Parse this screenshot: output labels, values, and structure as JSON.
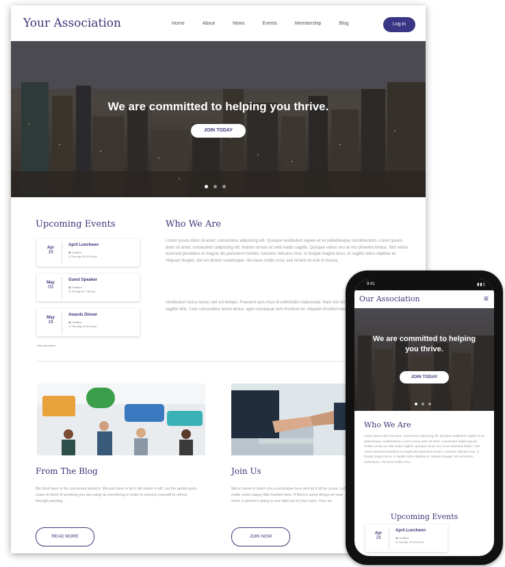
{
  "desktop": {
    "brand": "Your Association",
    "nav": [
      "Home",
      "About",
      "News",
      "Events",
      "Membership",
      "Blog"
    ],
    "login": "Log in",
    "hero_title": "We are committed to helping you thrive.",
    "hero_button": "JOIN TODAY",
    "events_title": "Upcoming Events",
    "events": [
      {
        "month": "Apr",
        "day": "16",
        "title": "April Luncheon",
        "location": "Location",
        "time": "Tue Apr 16 12:00 pm"
      },
      {
        "month": "May",
        "day": "03",
        "title": "Guest Speaker",
        "location": "Location",
        "time": "Fri May 03 7:00 pm"
      },
      {
        "month": "May",
        "day": "16",
        "title": "Awards Dinner",
        "location": "Location",
        "time": "Thu May 16 6:00 pm"
      }
    ],
    "events_link": "View all events",
    "who_title": "Who We Are",
    "who_p1": "Lorem ipsum dolor sit amet, consectetur adipiscing elit. Quisque vestibulum sapien et ex pellentesque condimentum. Lorem ipsum dolor sit amet, consectetur adipiscing elit. Nullam ornare ac velit mattis sagittis. Quisque varius orci at orci pharetra finibus. Nisl varius euismod penatibus et magnis dis parturient montes, nascetur ridiculus mus. In feugiat magna lacus, in sagittis tellus dapibus et. Aliquam feugiat, nisl vel dictum scelerisque, nisi lacus mollis urna, sed ornare mi erat ut massa.",
    "who_p2": "Vestibulum luctus lectus sed est tempor. Praesent quis risus id sollicitudin malesuada. Nam non tortor id mauris pharetra porta quis sagittis felis. Cras consectetur lectus lectus, eget consequat sem tincidunt ex. Aliquam tincidunt lacus sapien vitae auctor.",
    "blog_title": "From The Blog",
    "blog_text": "We dont have to be concerned about it. We just have to let it fall where it will. Let the gentle push. Learn to think of anything you are using as something in order to express yourself to others through painting.",
    "blog_button": "READ MORE",
    "join_title": "Join Us",
    "join_text": "We're home to teach you a technique here and let it all be yours. Let's make some happy little bushes here. If there's some things on your mind, a painter's going to see right out of your eyes. Your art.",
    "join_button": "JOIN NOW"
  },
  "mobile": {
    "time": "9:41",
    "brand": "Our Association",
    "menu_icon": "hamburger-icon",
    "hero_title": "We are committed to helping you thrive.",
    "hero_button": "JOIN TODAY",
    "who_title": "Who We Are",
    "who_text": "Lorem ipsum dolor sit amet, consectetur adipiscing elit. Quisque vestibulum sapien et ex pellentesque condimentum. Lorem ipsum dolor sit amet, consectetur adipiscing elit. Nullam ornare ac velit mattis sagittis. Quisque varius orci at orci pharetra finibus. Nisl varius euismod penatibus et magnis dis parturient montes, nascetur ridiculus mus. In feugiat magna lacus, in sagittis tellus dapibus et. Aliquam feugiat, nisl vel dictum scelerisque, nisi lacus mollis urna.",
    "events_title": "Upcoming Events",
    "event": {
      "month": "Apr",
      "day": "16",
      "title": "April Luncheon",
      "location": "Location",
      "time": "Tue Apr 16 12:00 pm"
    }
  },
  "colors": {
    "brand": "#3b3577",
    "login_bg": "#3b3586"
  }
}
